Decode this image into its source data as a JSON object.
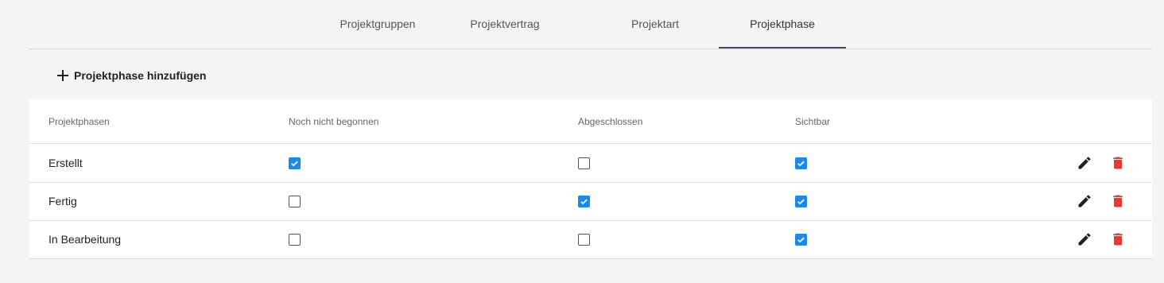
{
  "tabs": [
    {
      "label": "Projektgruppen",
      "active": false
    },
    {
      "label": "Projektvertrag",
      "active": false
    },
    {
      "label": "Projektart",
      "active": false
    },
    {
      "label": "Projektphase",
      "active": true
    }
  ],
  "add_button": {
    "label": "Projektphase hinzufügen",
    "icon": "plus-icon"
  },
  "table": {
    "columns": [
      "Projektphasen",
      "Noch nicht begonnen",
      "Abgeschlossen",
      "Sichtbar"
    ],
    "rows": [
      {
        "name": "Erstellt",
        "not_started": true,
        "completed": false,
        "visible": true
      },
      {
        "name": "Fertig",
        "not_started": false,
        "completed": true,
        "visible": true
      },
      {
        "name": "In Bearbeitung",
        "not_started": false,
        "completed": false,
        "visible": true
      }
    ],
    "row_actions": [
      "edit-icon",
      "delete-icon"
    ]
  },
  "colors": {
    "accent": "#1e88e5",
    "delete": "#e53935",
    "tab_indicator": "#4a4560"
  }
}
